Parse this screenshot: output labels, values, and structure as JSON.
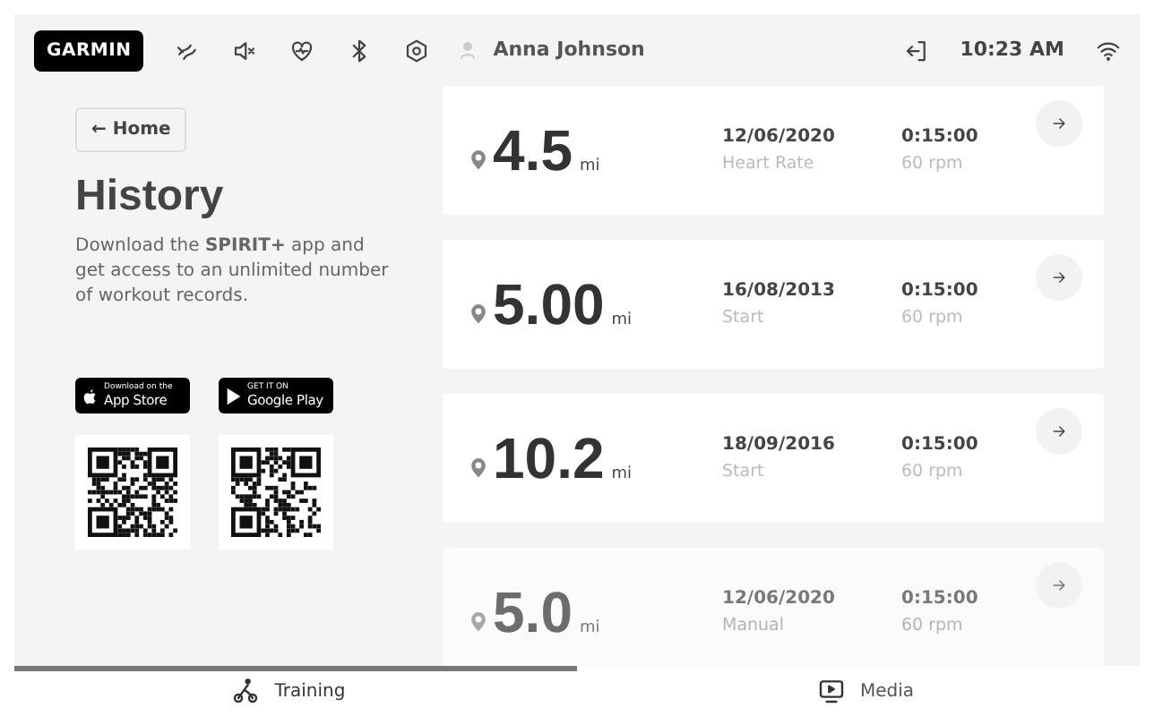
{
  "top_bar": {
    "brand": "GARMIN",
    "user": "Anna Johnson",
    "time": "10:23 AM"
  },
  "sidebar": {
    "back": "← Home",
    "title": "History",
    "text": "Download the **SPIRIT+** app and get access to an unlimited number of workout records.",
    "badges": [
      {
        "kind": "apple",
        "small": "Download on the",
        "big": "App Store"
      },
      {
        "kind": "google",
        "small": "GET IT ON",
        "big": "Google Play"
      }
    ]
  },
  "records": [
    {
      "distance": "4.5",
      "unit": "mi",
      "date": "12/06/2020",
      "mode": "Heart Rate",
      "duration": "0:15:00",
      "cadence": "60 rpm",
      "faded": false
    },
    {
      "distance": "5.00",
      "unit": "mi",
      "date": "16/08/2013",
      "mode": "Start",
      "duration": "0:15:00",
      "cadence": "60 rpm",
      "faded": false
    },
    {
      "distance": "10.2",
      "unit": "mi",
      "date": "18/09/2016",
      "mode": "Start",
      "duration": "0:15:00",
      "cadence": "60 rpm",
      "faded": false
    },
    {
      "distance": "5.0",
      "unit": "mi",
      "date": "12/06/2020",
      "mode": "Manual",
      "duration": "0:15:00",
      "cadence": "60 rpm",
      "faded": true
    }
  ],
  "tabs": [
    {
      "label": "Training",
      "kind": "cyclist",
      "selected": true
    },
    {
      "label": "Media",
      "kind": "play",
      "selected": false
    }
  ]
}
